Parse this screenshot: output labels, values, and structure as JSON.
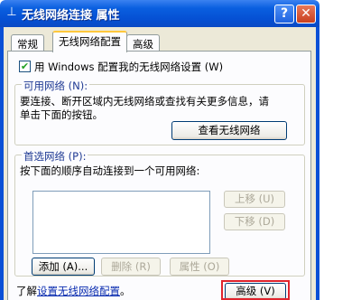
{
  "window": {
    "title": "无线网络连接 属性",
    "help_glyph": "?",
    "close_glyph": "✕",
    "icon_glyph": "⊥"
  },
  "tabs": [
    {
      "label": "常规",
      "active": false
    },
    {
      "label": "无线网络配置",
      "active": true
    },
    {
      "label": "高级",
      "active": false
    }
  ],
  "use_windows_checkbox": {
    "checked": true,
    "mark": "✔",
    "label": "用 Windows 配置我的无线网络设置 (W)"
  },
  "available_networks": {
    "group_label": "可用网络 (N):",
    "description_line1": "要连接、断开区域内无线网络或查找有关更多信息，请",
    "description_line2": "单击下面的按钮。",
    "view_button": "查看无线网络"
  },
  "preferred_networks": {
    "group_label": "首选网络 (P):",
    "description": "按下面的顺序自动连接到一个可用网络:",
    "list_items": [],
    "move_up_button": "上移 (U)",
    "move_down_button": "下移 (D)",
    "add_button": "添加 (A)...",
    "remove_button": "删除 (R)",
    "properties_button": "属性 (O)"
  },
  "footer": {
    "learn_prefix": "了解",
    "learn_link": "设置无线网络配置",
    "learn_suffix": "。",
    "advanced_button": "高级 (V)"
  },
  "colors": {
    "titlebar": "#0a5fe0",
    "dialog_bg": "#ece9d8",
    "panel_bg": "#fcfcfe",
    "highlight": "#e0242d",
    "group_label": "#1f3a93"
  }
}
